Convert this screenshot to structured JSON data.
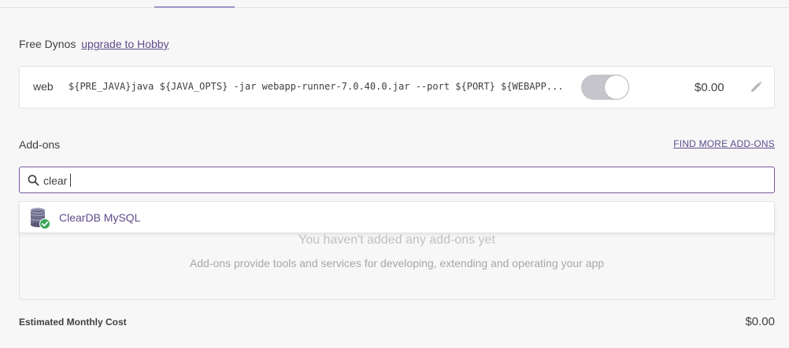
{
  "dynos": {
    "header_text": "Free Dynos",
    "upgrade_link": "upgrade to Hobby",
    "process": {
      "type": "web",
      "command": "${PRE_JAVA}java ${JAVA_OPTS} -jar webapp-runner-7.0.40.0.jar --port ${PORT} ${WEBAPP...",
      "enabled": true,
      "price": "$0.00"
    }
  },
  "addons": {
    "title": "Add-ons",
    "find_more_link": "FIND MORE ADD-ONS",
    "search": {
      "value": "clear",
      "placeholder": ""
    },
    "results": [
      {
        "name": "ClearDB MySQL",
        "icon": "cleardb-database-icon"
      }
    ],
    "empty_state": {
      "title": "You haven't added any add-ons yet",
      "subtitle": "Add-ons provide tools and services for developing, extending and operating your app"
    }
  },
  "footer": {
    "estimated_label": "Estimated Monthly Cost",
    "estimated_value": "$0.00"
  },
  "colors": {
    "accent": "#79589f",
    "link": "#5e4b8b",
    "success": "#3aa65a"
  }
}
